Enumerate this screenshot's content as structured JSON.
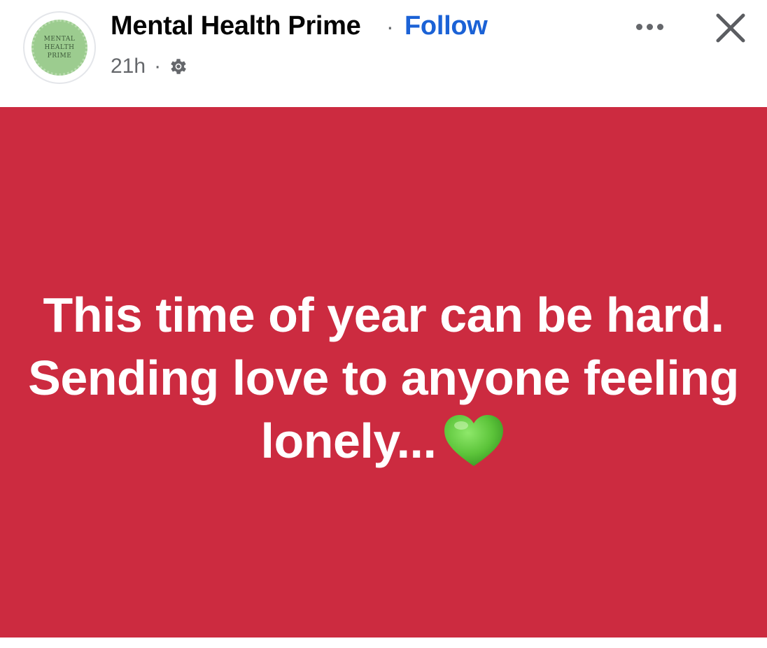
{
  "post": {
    "avatar_text_line1": "MENTAL",
    "avatar_text_line2": "HEALTH PRIME",
    "page_name": "Mental Health Prime",
    "separator": "·",
    "follow_label": "Follow",
    "timestamp": "21h",
    "meta_separator": "·",
    "audience_icon": "gear-icon",
    "more_icon": "more-options-icon",
    "close_icon": "close-icon",
    "text": "This time of year can be hard. Sending love to anyone feeling lonely...",
    "emoji": "green-heart",
    "background_color": "#cc2b40",
    "follow_color": "#1b62d6"
  }
}
